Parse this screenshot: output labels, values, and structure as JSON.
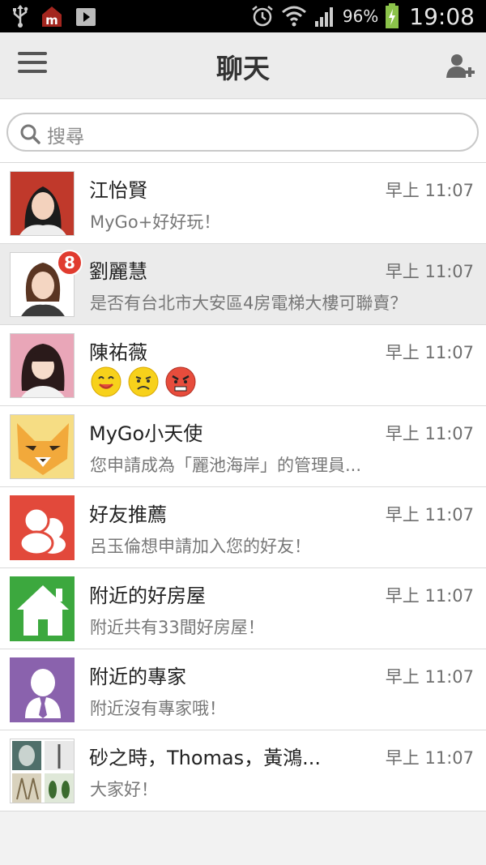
{
  "status_bar": {
    "battery_percent": "96%",
    "time": "19:08",
    "left_icons": [
      "usb-icon",
      "app-m-icon",
      "play-store-icon"
    ],
    "right_icons": [
      "alarm-icon",
      "wifi-icon",
      "signal-icon",
      "battery-icon"
    ]
  },
  "header": {
    "title": "聊天",
    "menu_icon": "hamburger-menu-icon",
    "action_icon": "add-friend-icon"
  },
  "search": {
    "placeholder": "搜尋"
  },
  "chats": [
    {
      "name": "江怡賢",
      "time": "早上 11:07",
      "message": "MyGo+好好玩！",
      "avatar": "photo-woman-red-background"
    },
    {
      "name": "劉麗慧",
      "time": "早上 11:07",
      "message": "是否有台北市大安區4房電梯大樓可聯賣？",
      "badge": "8",
      "avatar": "photo-woman-white-background"
    },
    {
      "name": "陳祐薇",
      "time": "早上 11:07",
      "message": "",
      "emojis": [
        "smile-emoji",
        "sad-emoji",
        "angry-emoji"
      ],
      "avatar": "photo-woman-pink-background"
    },
    {
      "name": "MyGo小天使",
      "time": "早上 11:07",
      "message": "您申請成為「麗池海岸」的管理員...",
      "avatar": "fox-mascot-icon"
    },
    {
      "name": "好友推薦",
      "time": "早上 11:07",
      "message": "呂玉倫想申請加入您的好友！",
      "avatar": "friends-recommend-icon"
    },
    {
      "name": "附近的好房屋",
      "time": "早上 11:07",
      "message": "附近共有33間好房屋！",
      "avatar": "house-icon"
    },
    {
      "name": "附近的專家",
      "time": "早上 11:07",
      "message": "附近沒有專家哦！",
      "avatar": "expert-person-icon"
    },
    {
      "name": "砂之時，Thomas，黃鴻...",
      "time": "早上 11:07",
      "message": "大家好！",
      "avatar": "group-photo-collage"
    }
  ],
  "colors": {
    "badge": "#e03b2f",
    "friend_icon_bg": "#e2493b",
    "house_icon_bg": "#3ca83e",
    "expert_icon_bg": "#8a62ad",
    "fox_icon_bg": "#f6dd84"
  }
}
